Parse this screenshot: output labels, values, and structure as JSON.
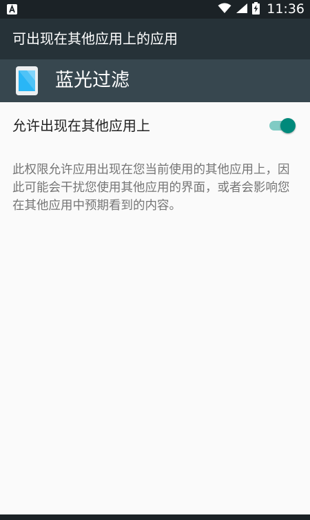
{
  "status_bar": {
    "time": "11:36",
    "icons": [
      "notification-a-icon",
      "wifi-icon",
      "signal-icon",
      "battery-charging-icon"
    ]
  },
  "toolbar": {
    "title": "可出现在其他应用上的应用"
  },
  "app": {
    "name": "蓝光过滤",
    "icon": "phone-app-icon"
  },
  "permission": {
    "label": "允许出现在其他应用上",
    "enabled": true,
    "description": "此权限允许应用出现在您当前使用的其他应用上，因此可能会干扰您使用其他应用的界面，或者会影响您在其他应用中预期看到的内容。"
  },
  "colors": {
    "status_bar": "#1b2226",
    "toolbar": "#263238",
    "app_header": "#37474f",
    "accent": "#00897b",
    "accent_track": "#80cbc4",
    "background": "#fafafa"
  }
}
